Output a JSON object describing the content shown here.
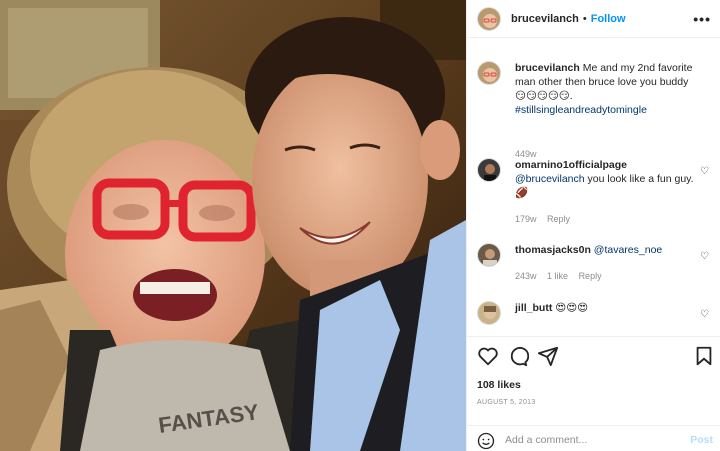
{
  "post": {
    "username": "brucevilanch",
    "separator": "•",
    "follow_label": "Follow",
    "more_label": "•••"
  },
  "comments": [
    {
      "username": "brucevilanch",
      "text": "Me and my 2nd favorite man other then bruce love you buddy😏😏😏😏😏.",
      "hashtag": "#stillsingleandreadytomingle",
      "time": "449w",
      "likes": "",
      "reply": ""
    },
    {
      "username": "omarnino1officialpage",
      "mention": "@brucevilanch",
      "text": "you look like a fun guy. 🏈",
      "time": "179w",
      "likes": "",
      "reply": "Reply"
    },
    {
      "username": "thomasjacks0n",
      "mention": "@tavares_noe",
      "text": "",
      "time": "243w",
      "likes": "1 like",
      "reply": "Reply"
    },
    {
      "username": "jill_butt",
      "text": "😍😍😍",
      "time": "",
      "likes": "",
      "reply": ""
    }
  ],
  "actions": {
    "likes": "108 likes",
    "date": "AUGUST 5, 2013",
    "comment_placeholder": "Add a comment...",
    "post_label": "Post"
  },
  "photo": {
    "shirt_text": "FANTASY"
  },
  "colors": {
    "accent": "#0095f6",
    "post_disabled": "#b2dffc",
    "muted": "#8e8e8e",
    "glasses": "#e0242f"
  }
}
